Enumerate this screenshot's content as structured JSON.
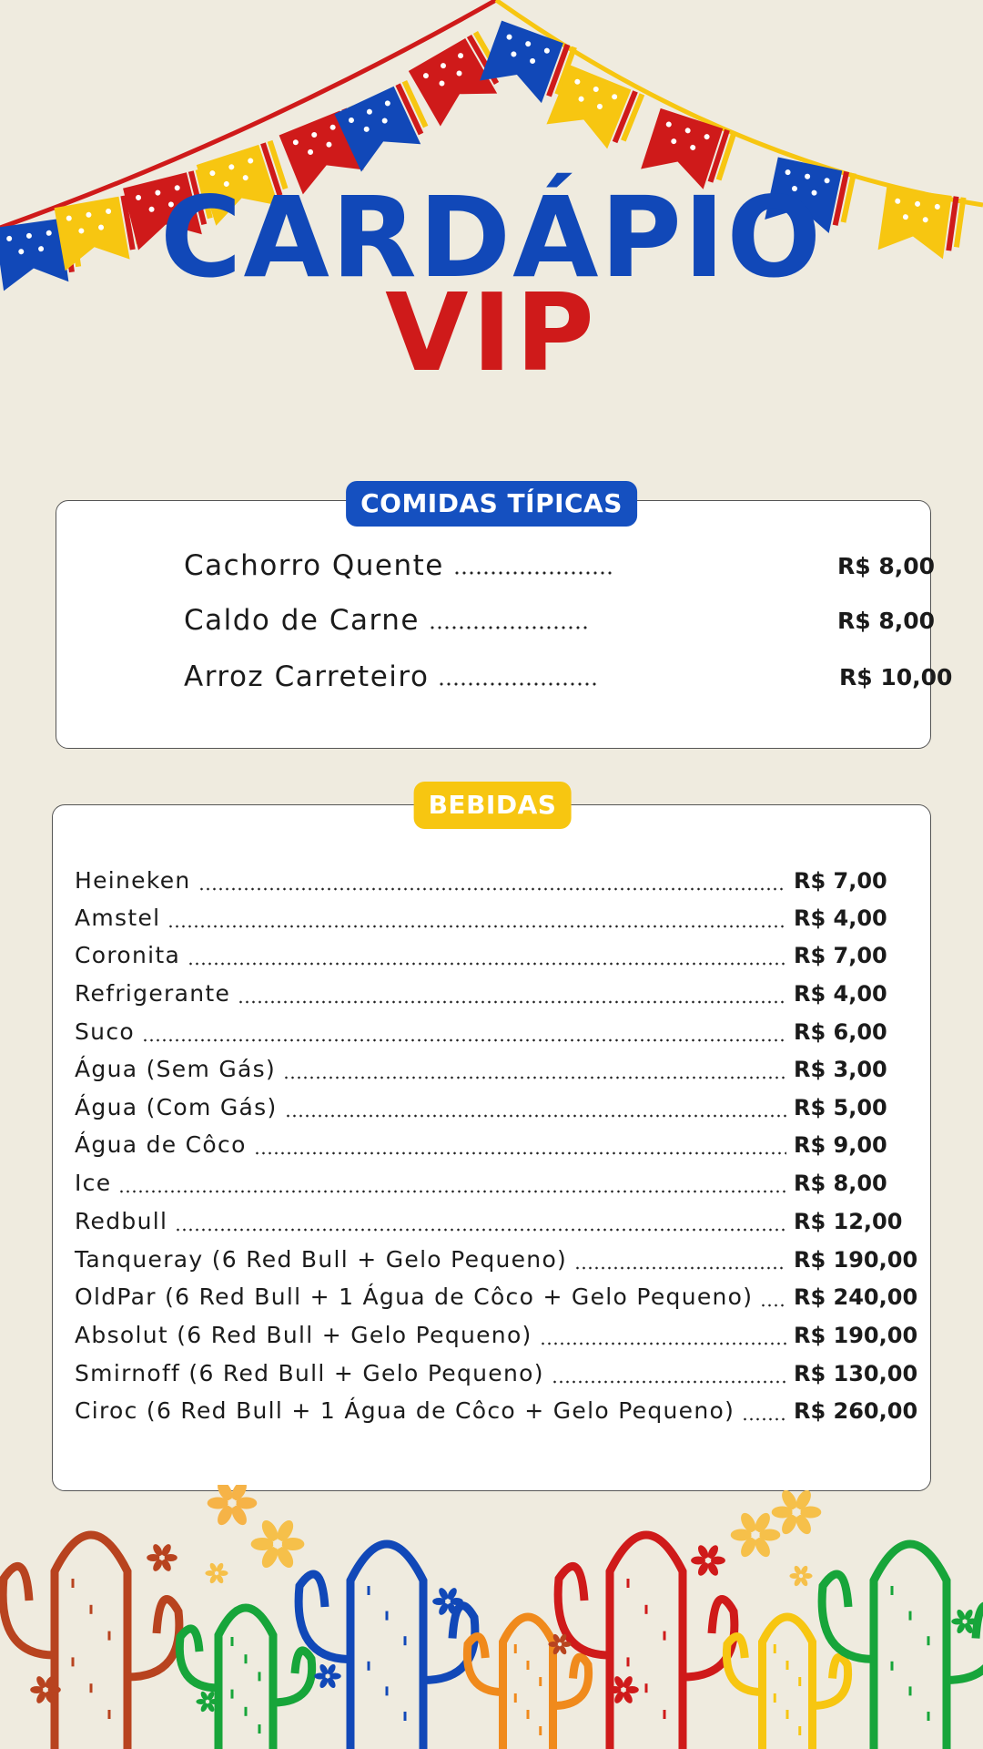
{
  "title": {
    "line1": "CARDÁPIO",
    "line2": "VIP"
  },
  "food": {
    "heading": "COMIDAS TÍPICAS",
    "items": [
      {
        "name": "Cachorro Quente",
        "price": "R$ 8,00"
      },
      {
        "name": "Caldo de Carne",
        "price": "R$ 8,00"
      },
      {
        "name": "Arroz Carreteiro",
        "price": "R$ 10,00"
      }
    ]
  },
  "drinks": {
    "heading": "BEBIDAS",
    "items": [
      {
        "name": "Heineken",
        "price": "R$ 7,00"
      },
      {
        "name": "Amstel",
        "price": "R$ 4,00"
      },
      {
        "name": "Coronita",
        "price": "R$ 7,00"
      },
      {
        "name": "Refrigerante",
        "price": "R$ 4,00"
      },
      {
        "name": "Suco",
        "price": "R$ 6,00"
      },
      {
        "name": "Água (Sem Gás)",
        "price": "R$ 3,00"
      },
      {
        "name": "Água (Com Gás)",
        "price": "R$ 5,00"
      },
      {
        "name": "Água de Côco",
        "price": "R$ 9,00"
      },
      {
        "name": "Ice",
        "price": "R$ 8,00"
      },
      {
        "name": "Redbull",
        "price": "R$ 12,00"
      },
      {
        "name": "Tanqueray (6 Red Bull + Gelo Pequeno)",
        "price": "R$ 190,00"
      },
      {
        "name": "OldPar (6 Red Bull + 1 Água de Côco + Gelo Pequeno)",
        "price": "R$ 240,00"
      },
      {
        "name": "Absolut (6 Red Bull + Gelo Pequeno)",
        "price": "R$ 190,00"
      },
      {
        "name": "Smirnoff (6 Red Bull + Gelo Pequeno)",
        "price": "R$ 130,00"
      },
      {
        "name": "Ciroc (6 Red Bull + 1 Água de Côco + Gelo Pequeno)",
        "price": "R$ 260,00"
      }
    ]
  },
  "colors": {
    "background": "#efebdf",
    "blue": "#1148b8",
    "red": "#cf1a1a",
    "yellow": "#f7c611",
    "green": "#17a53a",
    "orange": "#f08a1c",
    "rust": "#b8431f"
  },
  "decorations": [
    "festa-junina-bunting",
    "cactus-illustrations",
    "flower-icons"
  ]
}
